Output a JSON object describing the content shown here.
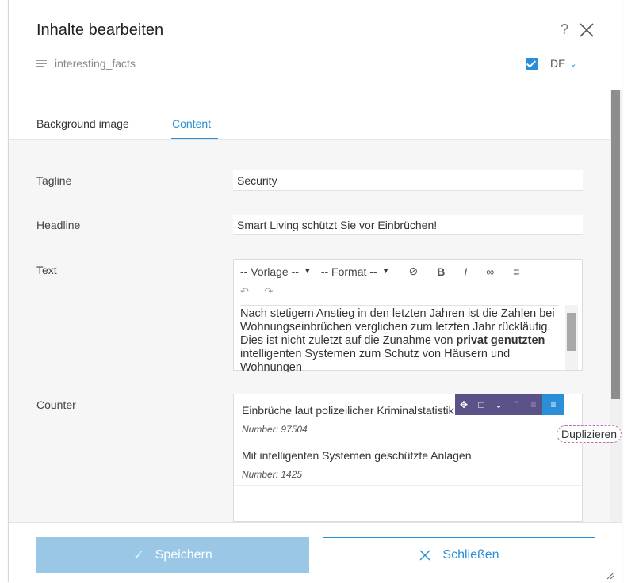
{
  "dialog": {
    "title": "Inhalte bearbeiten",
    "help": "?",
    "subtitle": "interesting_facts",
    "language": "DE",
    "language_checked": true
  },
  "tabs": [
    {
      "label": "Background image",
      "active": false
    },
    {
      "label": "Content",
      "active": true
    }
  ],
  "fields": {
    "tagline_label": "Tagline",
    "tagline_value": "Security",
    "headline_label": "Headline",
    "headline_value": "Smart Living schützt Sie vor Einbrüchen!",
    "text_label": "Text",
    "counter_label": "Counter"
  },
  "editor": {
    "template_select": "-- Vorlage --",
    "format_select": "-- Format --",
    "content_before_bold": "Nach stetigem Anstieg in den letzten Jahren ist die Zahlen bei Wohnungseinbrüchen verglichen zum letzten Jahr rückläufig. Dies ist nicht zuletzt auf die Zunahme von ",
    "content_bold": "privat genutzten",
    "content_after_bold": " intelligenten Systemen zum Schutz von Häusern und Wohnungen"
  },
  "counter_items": [
    {
      "title": "Einbrüche laut polizeilicher Kriminalstatistik",
      "number": "Number: 97504"
    },
    {
      "title": "Mit intelligenten Systemen geschützte Anlagen",
      "number": "Number: 1425"
    }
  ],
  "tooltip": "Duplizieren",
  "footer": {
    "save_label": "Speichern",
    "close_label": "Schließen"
  },
  "colors": {
    "accent": "#2a8fd8",
    "item_toolbar": "#5b5288",
    "save_disabled": "#9bc7e6"
  }
}
